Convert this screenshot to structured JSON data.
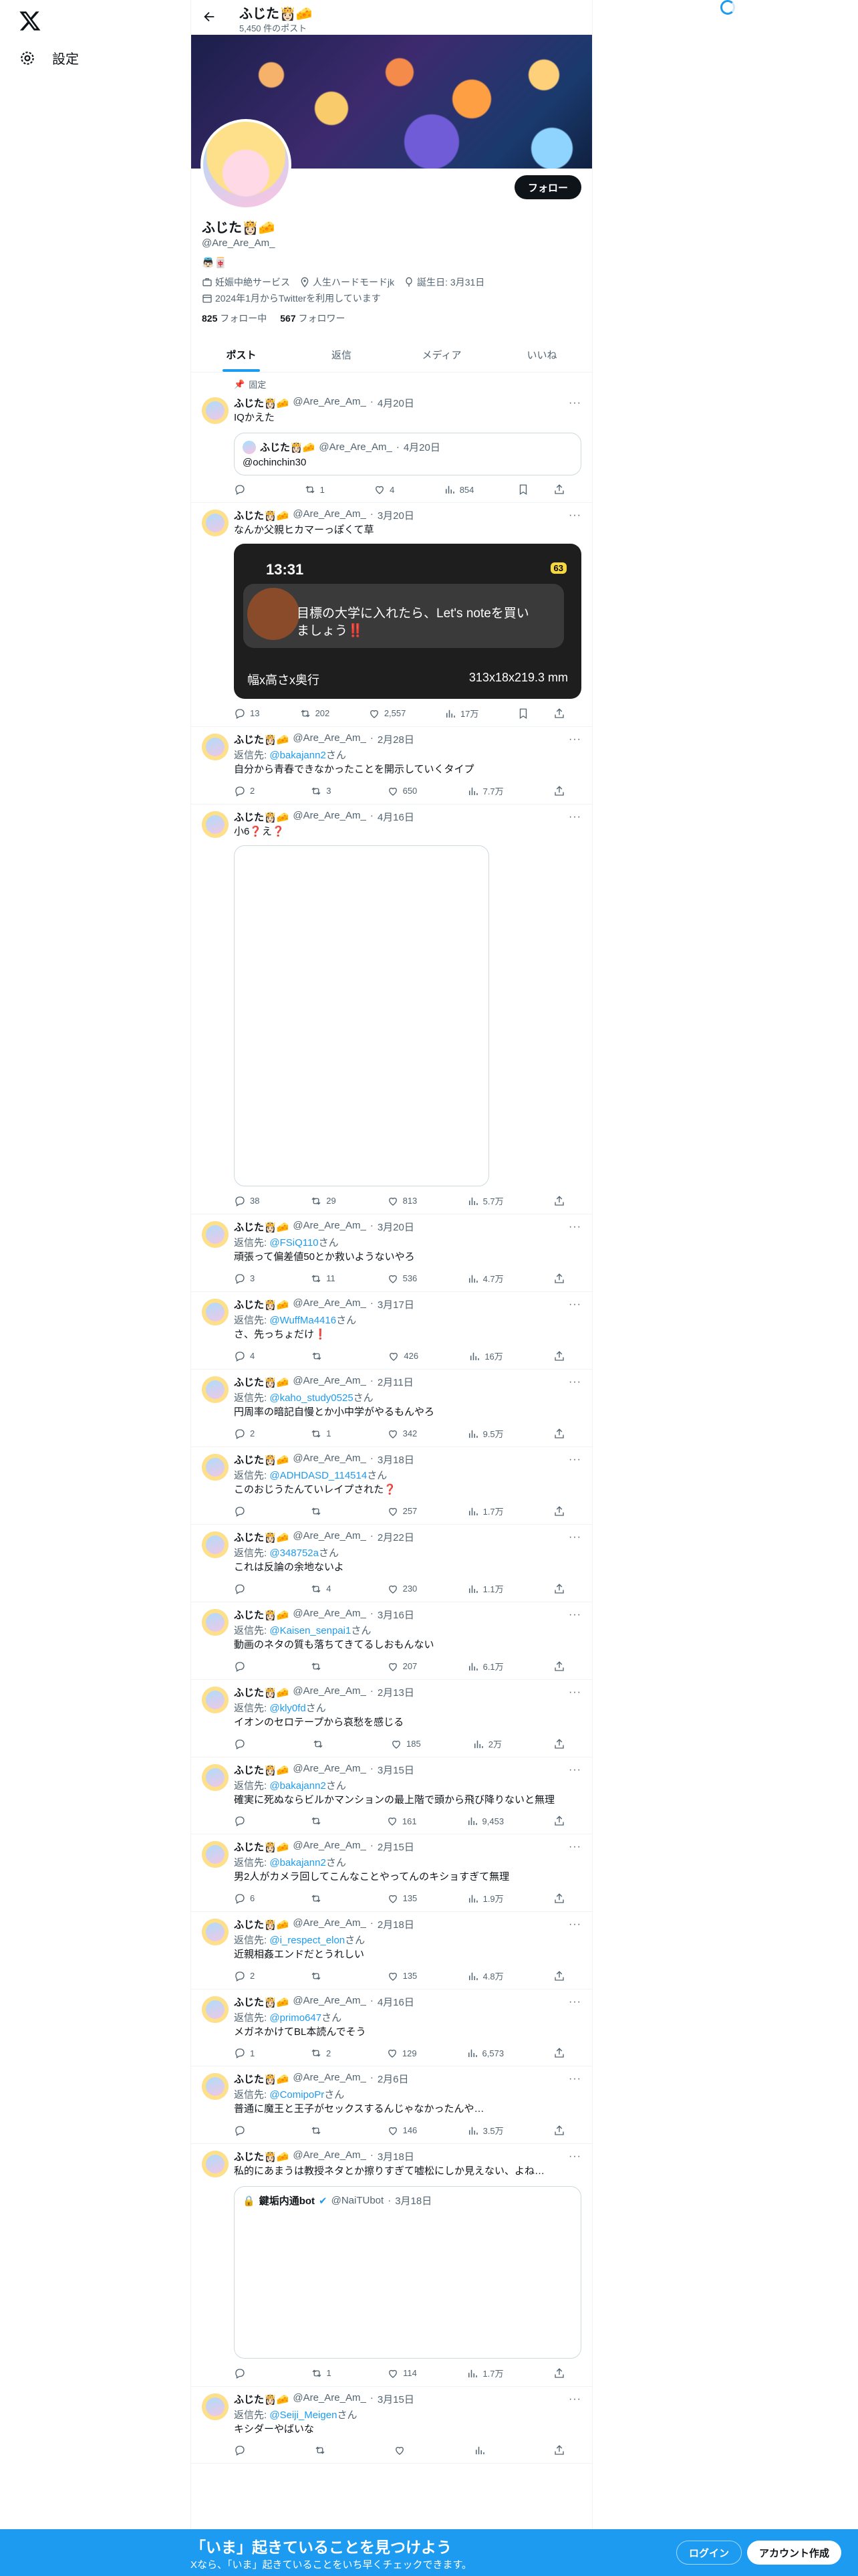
{
  "nav": {
    "settings_label": "設定"
  },
  "header": {
    "name": "ふじた👸🏻🧀",
    "post_count": "5,450 件のポスト"
  },
  "profile": {
    "name": "ふじた👸🏻🧀",
    "handle": "@Are_Are_Am_",
    "bio": "👼🏻🀄️",
    "occupation": "妊娠中絶サービス",
    "location": "人生ハードモードjk",
    "birthday": "誕生日: 3月31日",
    "joined": "2024年1月からTwitterを利用しています",
    "following_count": "825",
    "following_label": "フォロー中",
    "followers_count": "567",
    "followers_label": "フォロワー",
    "follow_label": "フォロー"
  },
  "tabs": [
    "ポスト",
    "返信",
    "メディア",
    "いいね"
  ],
  "pinned_label": "固定",
  "tweets": [
    {
      "name": "ふじた👸🏻🧀",
      "handle": "@Are_Are_Am_",
      "date": "4月20日",
      "reply_to": "",
      "text": "IQかえた",
      "quote": {
        "name": "ふじた👸🏻🧀",
        "handle": "@Are_Are_Am_",
        "date": "4月20日",
        "text": "@ochinchin30"
      },
      "replies": "",
      "retweets": "1",
      "likes": "4",
      "views": "854"
    },
    {
      "name": "ふじた👸🏻🧀",
      "handle": "@Are_Are_Am_",
      "date": "3月20日",
      "reply_to": "",
      "text": "なんか父親ヒカマーっぽくて草",
      "media": {
        "time": "13:31",
        "battery": "63",
        "message": "目標の大学に入れたら、Let's noteを買いましょう‼️",
        "dims_label": "幅x高さx奥行",
        "dims_value": "313x18x219.3 mm"
      },
      "replies": "13",
      "retweets": "202",
      "likes": "2,557",
      "views": "17万"
    },
    {
      "name": "ふじた👸🏻🧀",
      "handle": "@Are_Are_Am_",
      "date": "2月28日",
      "reply_to": "@bakajann2",
      "text": "自分から青春できなかったことを開示していくタイプ",
      "replies": "2",
      "retweets": "3",
      "likes": "650",
      "views": "7.7万"
    },
    {
      "name": "ふじた👸🏻🧀",
      "handle": "@Are_Are_Am_",
      "date": "4月16日",
      "reply_to": "",
      "text": "小6❓え❓",
      "blank_media": true,
      "replies": "38",
      "retweets": "29",
      "likes": "813",
      "views": "5.7万"
    },
    {
      "name": "ふじた👸🏻🧀",
      "handle": "@Are_Are_Am_",
      "date": "3月20日",
      "reply_to": "@FSiQ110",
      "text": "頑張って偏差値50とか救いようないやろ",
      "replies": "3",
      "retweets": "11",
      "likes": "536",
      "views": "4.7万"
    },
    {
      "name": "ふじた👸🏻🧀",
      "handle": "@Are_Are_Am_",
      "date": "3月17日",
      "reply_to": "@WuffMa4416",
      "text": "さ、先っちょだけ❗️",
      "replies": "4",
      "retweets": "",
      "likes": "426",
      "views": "16万"
    },
    {
      "name": "ふじた👸🏻🧀",
      "handle": "@Are_Are_Am_",
      "date": "2月11日",
      "reply_to": "@kaho_study0525",
      "text": "円周率の暗記自慢とか小中学がやるもんやろ",
      "replies": "2",
      "retweets": "1",
      "likes": "342",
      "views": "9.5万"
    },
    {
      "name": "ふじた👸🏻🧀",
      "handle": "@Are_Are_Am_",
      "date": "3月18日",
      "reply_to": "@ADHDASD_114514",
      "text": "このおじうたんていレイプされた❓",
      "replies": "",
      "retweets": "",
      "likes": "257",
      "views": "1.7万"
    },
    {
      "name": "ふじた👸🏻🧀",
      "handle": "@Are_Are_Am_",
      "date": "2月22日",
      "reply_to": "@348752a",
      "text": "これは反論の余地ないよ",
      "replies": "",
      "retweets": "4",
      "likes": "230",
      "views": "1.1万"
    },
    {
      "name": "ふじた👸🏻🧀",
      "handle": "@Are_Are_Am_",
      "date": "3月16日",
      "reply_to": "@Kaisen_senpai1",
      "text": "動画のネタの質も落ちてきてるしおもんない",
      "replies": "",
      "retweets": "",
      "likes": "207",
      "views": "6.1万"
    },
    {
      "name": "ふじた👸🏻🧀",
      "handle": "@Are_Are_Am_",
      "date": "2月13日",
      "reply_to": "@kly0fd",
      "text": "イオンのセロテープから哀愁を感じる",
      "replies": "",
      "retweets": "",
      "likes": "185",
      "views": "2万"
    },
    {
      "name": "ふじた👸🏻🧀",
      "handle": "@Are_Are_Am_",
      "date": "3月15日",
      "reply_to": "@bakajann2",
      "text": "確実に死ぬならビルかマンションの最上階で頭から飛び降りないと無理",
      "replies": "",
      "retweets": "",
      "likes": "161",
      "views": "9,453"
    },
    {
      "name": "ふじた👸🏻🧀",
      "handle": "@Are_Are_Am_",
      "date": "2月15日",
      "reply_to": "@bakajann2",
      "text": "男2人がカメラ回してこんなことやってんのキショすぎて無理",
      "replies": "6",
      "retweets": "",
      "likes": "135",
      "views": "1.9万"
    },
    {
      "name": "ふじた👸🏻🧀",
      "handle": "@Are_Are_Am_",
      "date": "2月18日",
      "reply_to": "@i_respect_elon",
      "text": "近親相姦エンドだとうれしい",
      "replies": "2",
      "retweets": "",
      "likes": "135",
      "views": "4.8万"
    },
    {
      "name": "ふじた👸🏻🧀",
      "handle": "@Are_Are_Am_",
      "date": "4月16日",
      "reply_to": "@primo647",
      "text": "メガネかけてBL本読んでそう",
      "replies": "1",
      "retweets": "2",
      "likes": "129",
      "views": "6,573"
    },
    {
      "name": "ふじた👸🏻🧀",
      "handle": "@Are_Are_Am_",
      "date": "2月6日",
      "reply_to": "@ComipoPr",
      "text": "普通に魔王と王子がセックスするんじゃなかったんや…",
      "replies": "",
      "retweets": "",
      "likes": "146",
      "views": "3.5万"
    },
    {
      "name": "ふじた👸🏻🧀",
      "handle": "@Are_Are_Am_",
      "date": "3月18日",
      "reply_to": "",
      "text": "私的にあまうは教授ネタとか擦りすぎて嘘松にしか見えない、よね…",
      "quote_tall": {
        "name": "鍵垢内通bot",
        "handle": "@NaiTUbot",
        "date": "3月18日"
      },
      "replies": "",
      "retweets": "1",
      "likes": "114",
      "views": "1.7万"
    },
    {
      "name": "ふじた👸🏻🧀",
      "handle": "@Are_Are_Am_",
      "date": "3月15日",
      "reply_to": "@Seiji_Meigen",
      "text": "キシダーやばいな",
      "replies": "",
      "retweets": "",
      "likes": "",
      "views": ""
    }
  ],
  "reply_prefix": "返信先: ",
  "reply_suffix": "さん",
  "bottom_bar": {
    "title": "「いま」起きていることを見つけよう",
    "subtitle": "Xなら、「いま」起きていることをいち早くチェックできます。",
    "login": "ログイン",
    "signup": "アカウント作成"
  },
  "colors": {
    "accent": "#1d9bf0",
    "text": "#0f1419",
    "muted": "#536471"
  }
}
